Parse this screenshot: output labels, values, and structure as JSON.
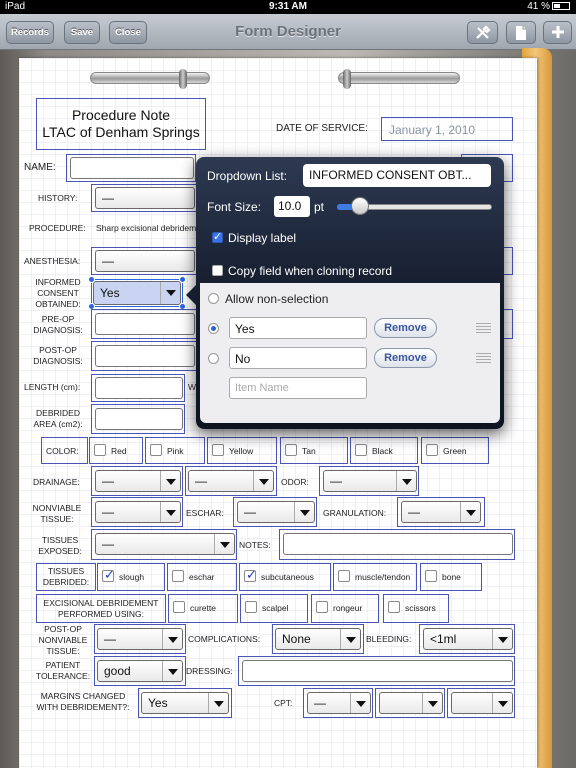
{
  "status": {
    "device": "iPad",
    "time": "9:31 AM",
    "battery": "41 %"
  },
  "nav": {
    "title": "Form Designer",
    "records": "Records",
    "save": "Save",
    "close": "Close"
  },
  "form": {
    "title_line1": "Procedure Note",
    "title_line2": "LTAC of Denham Springs",
    "date_label": "DATE OF SERVICE:",
    "date_value": "January 1, 2010",
    "name_label": "NAME:",
    "history_label": "HISTORY:",
    "history_value": "—",
    "procedure_label": "PROCEDURE:",
    "procedure_text": "Sharp excisional debrideme",
    "anesthesia_label": "ANESTHESIA:",
    "anesthesia_value": "—",
    "consent_label": "INFORMED CONSENT OBTAINED:",
    "consent_value": "Yes",
    "preop_label": "PRE-OP DIAGNOSIS:",
    "postop_label": "POST-OP DIAGNOSIS:",
    "length_label": "LENGTH (cm):",
    "width_label": "W",
    "debrided_label": "DEBRIDED AREA (cm2):",
    "color_label": "COLOR:",
    "colors": [
      {
        "label": "Red",
        "checked": false
      },
      {
        "label": "Pink",
        "checked": false
      },
      {
        "label": "Yellow",
        "checked": false
      },
      {
        "label": "Tan",
        "checked": false
      },
      {
        "label": "Black",
        "checked": false
      },
      {
        "label": "Green",
        "checked": false
      }
    ],
    "drainage_label": "DRAINAGE:",
    "drainage_1": "—",
    "drainage_2": "—",
    "odor_label": "ODOR:",
    "odor_value": "—",
    "nonviable_label": "NONVIABLE TISSUE:",
    "nonviable_value": "—",
    "eschar_label": "ESCHAR:",
    "eschar_value": "—",
    "granulation_label": "GRANULATION:",
    "granulation_value": "—",
    "exposed_label": "TISSUES EXPOSED:",
    "exposed_value": "—",
    "notes_label": "NOTES:",
    "debrided_tissues_label": "TISSUES DEBRIDED:",
    "tissues": [
      {
        "label": "slough",
        "checked": true
      },
      {
        "label": "eschar",
        "checked": false
      },
      {
        "label": "subcutaneous",
        "checked": true
      },
      {
        "label": "muscle/tendon",
        "checked": false
      },
      {
        "label": "bone",
        "checked": false
      }
    ],
    "excisional_label": "EXCISIONAL DEBRIDEMENT PERFORMED USING:",
    "instruments": [
      {
        "label": "curette",
        "checked": false
      },
      {
        "label": "scalpel",
        "checked": false
      },
      {
        "label": "rongeur",
        "checked": false
      },
      {
        "label": "scissors",
        "checked": false
      }
    ],
    "postop_nonviable_label": "POST-OP NONVIABLE TISSUE:",
    "postop_nonviable_value": "—",
    "complications_label": "COMPLICATIONS:",
    "complications_value": "None",
    "bleeding_label": "BLEEDING:",
    "bleeding_value": "<1ml",
    "tolerance_label": "PATIENT TOLERANCE:",
    "tolerance_value": "good",
    "dressing_label": "DRESSING:",
    "margins_label": "MARGINS CHANGED WITH DEBRIDEMENT?:",
    "margins_value": "Yes",
    "cpt_label": "CPT:",
    "cpt_1": "—",
    "cpt_2": "",
    "cpt_3": ""
  },
  "popover": {
    "dropdown_list_label": "Dropdown List:",
    "dropdown_list_value": "INFORMED CONSENT OBT...",
    "font_size_label": "Font Size:",
    "font_size_value": "10.0",
    "font_size_unit": "pt",
    "font_size_slider_fraction": 0.1,
    "display_label": "Display label",
    "display_label_checked": true,
    "copy_field_label": "Copy field when cloning record",
    "copy_field_checked": false,
    "allow_nonselection": "Allow non-selection",
    "options": [
      {
        "value": "Yes",
        "selected": true,
        "remove": "Remove"
      },
      {
        "value": "No",
        "selected": false,
        "remove": "Remove"
      }
    ],
    "new_item_placeholder": "Item Name"
  }
}
